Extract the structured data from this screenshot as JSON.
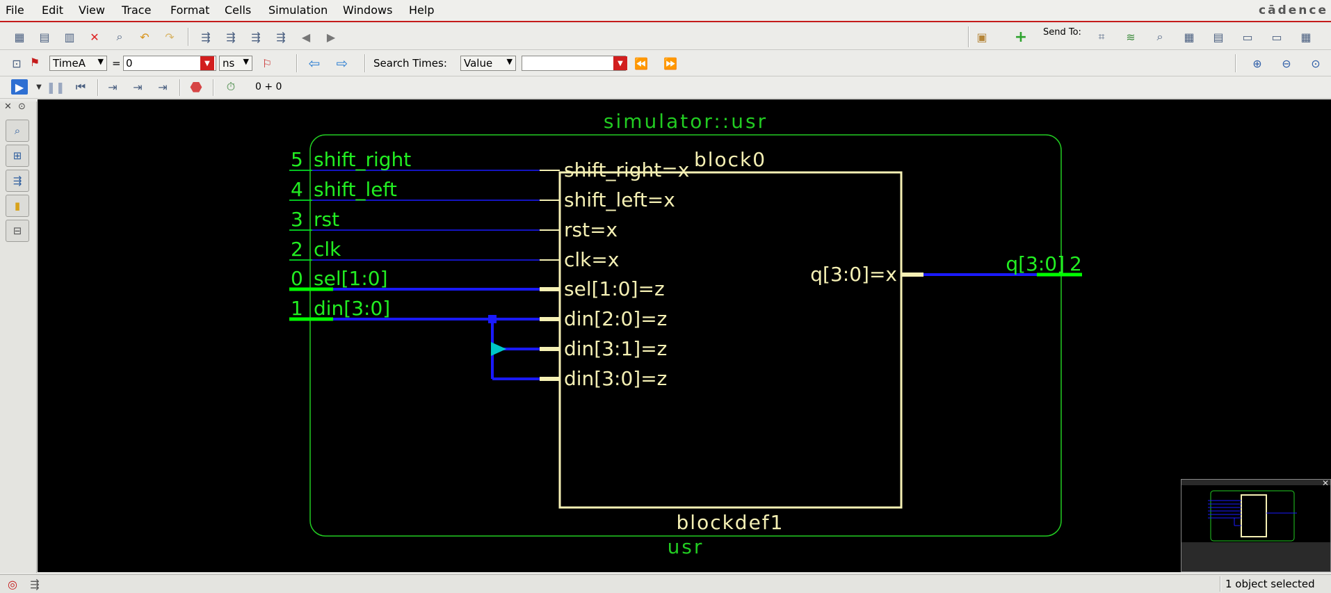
{
  "menu": [
    "File",
    "Edit",
    "View",
    "Trace",
    "Format",
    "Cells",
    "Simulation",
    "Windows",
    "Help"
  ],
  "brand": "cādence",
  "toolbar2": {
    "cursor_select": "TimeA",
    "equals": "=",
    "time_value": "0",
    "time_unit": "ns",
    "search_times_label": "Search Times:",
    "search_mode": "Value",
    "search_value": "",
    "send_to_label": "Send To:"
  },
  "toolbar3": {
    "sim_time": "0 + 0"
  },
  "schematic": {
    "scope_title": "simulator::usr",
    "scope_footer": "usr",
    "block_title": "block0",
    "block_footer": "blockdef1",
    "inputs": [
      {
        "index": "5",
        "name": "shift_right",
        "pin": "shift_right=x"
      },
      {
        "index": "4",
        "name": "shift_left",
        "pin": "shift_left=x"
      },
      {
        "index": "3",
        "name": "rst",
        "pin": "rst=x"
      },
      {
        "index": "2",
        "name": "clk",
        "pin": "clk=x"
      },
      {
        "index": "0",
        "name": "sel[1:0]",
        "pin": "sel[1:0]=z"
      },
      {
        "index": "1",
        "name": "din[3:0]",
        "pin": "din[2:0]=z"
      }
    ],
    "extra_pins": [
      "din[3:1]=z",
      "din[3:0]=z"
    ],
    "output": {
      "pin": "q[3:0]=x",
      "name": "q[3:0]",
      "index": "2"
    },
    "colors": {
      "scope": "#22cc22",
      "block": "#f5f0b4",
      "wire": "#1a1aff",
      "port": "#00ff00",
      "tap": "#00c8c8"
    }
  },
  "status": {
    "selection": "1 object selected"
  }
}
